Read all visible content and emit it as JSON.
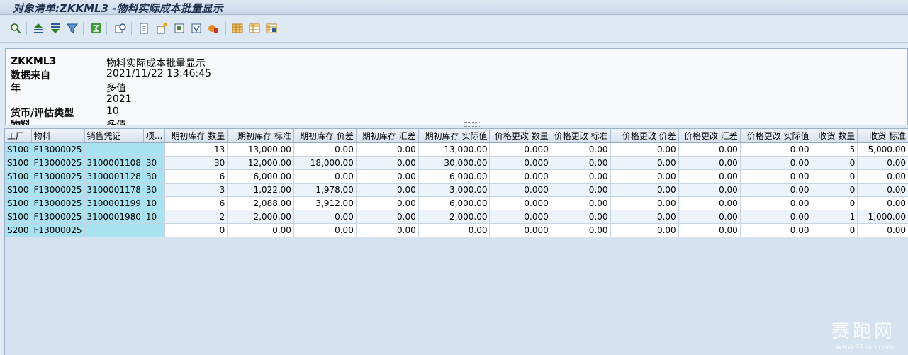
{
  "window": {
    "title": "对象清单:ZKKML3 -物料实际成本批量显示"
  },
  "toolbar": {
    "buttons": [
      {
        "name": "details-icon"
      },
      {
        "name": "sort-ascending-icon"
      },
      {
        "name": "sort-descending-icon"
      },
      {
        "name": "filter-icon"
      },
      {
        "name": "sum-icon"
      },
      {
        "name": "subtotal-icon"
      },
      {
        "name": "print-preview-icon"
      },
      {
        "name": "export-excel-icon"
      },
      {
        "name": "word-processing-icon"
      },
      {
        "name": "local-file-icon"
      },
      {
        "name": "abc-analysis-icon"
      },
      {
        "name": "select-layout-icon"
      },
      {
        "name": "change-layout-icon"
      },
      {
        "name": "save-layout-icon"
      }
    ]
  },
  "header": {
    "rows": [
      {
        "label": "ZKKML3",
        "value": "物料实际成本批量显示"
      },
      {
        "label": "数据来自",
        "value": "2021/11/22 13:46:45"
      },
      {
        "label": "年",
        "value": "多值"
      },
      {
        "label": "",
        "value": "2021"
      },
      {
        "label": "货币/评估类型",
        "value": "10"
      },
      {
        "label": "物料",
        "value": "多值"
      }
    ]
  },
  "grid": {
    "columns": [
      "工厂",
      "物料",
      "销售凭证",
      "项...",
      "期初库存 数量",
      "期初库存 标准",
      "期初库存 价差",
      "期初库存 汇差",
      "期初库存 实际值",
      "价格更改 数量",
      "价格更改 标准",
      "价格更改 价差",
      "价格更改 汇差",
      "价格更改 实际值",
      "收货 数量",
      "收货 标准"
    ],
    "rows": [
      [
        "S100",
        "F13000025",
        "",
        "",
        "13",
        "13,000.00",
        "0.00",
        "0.00",
        "13,000.00",
        "0.000",
        "0.00",
        "0.00",
        "0.00",
        "0.00",
        "5",
        "5,000.00"
      ],
      [
        "S100",
        "F13000025",
        "3100001108",
        "30",
        "30",
        "12,000.00",
        "18,000.00",
        "0.00",
        "30,000.00",
        "0.000",
        "0.00",
        "0.00",
        "0.00",
        "0.00",
        "0",
        "0.00"
      ],
      [
        "S100",
        "F13000025",
        "3100001128",
        "30",
        "6",
        "6,000.00",
        "0.00",
        "0.00",
        "6,000.00",
        "0.000",
        "0.00",
        "0.00",
        "0.00",
        "0.00",
        "0",
        "0.00"
      ],
      [
        "S100",
        "F13000025",
        "3100001178",
        "30",
        "3",
        "1,022.00",
        "1,978.00",
        "0.00",
        "3,000.00",
        "0.000",
        "0.00",
        "0.00",
        "0.00",
        "0.00",
        "0",
        "0.00"
      ],
      [
        "S100",
        "F13000025",
        "3100001199",
        "10",
        "6",
        "2,088.00",
        "3,912.00",
        "0.00",
        "6,000.00",
        "0.000",
        "0.00",
        "0.00",
        "0.00",
        "0.00",
        "0",
        "0.00"
      ],
      [
        "S100",
        "F13000025",
        "3100001980",
        "10",
        "2",
        "2,000.00",
        "0.00",
        "0.00",
        "2,000.00",
        "0.000",
        "0.00",
        "0.00",
        "0.00",
        "0.00",
        "1",
        "1,000.00"
      ],
      [
        "S200",
        "F13000025",
        "",
        "",
        "0",
        "0.00",
        "0.00",
        "0.00",
        "0.00",
        "0.000",
        "0.00",
        "0.00",
        "0.00",
        "0.00",
        "0",
        "0.00"
      ]
    ]
  },
  "watermark": {
    "brand": "赛跑网",
    "url": "www.91sap.com"
  }
}
